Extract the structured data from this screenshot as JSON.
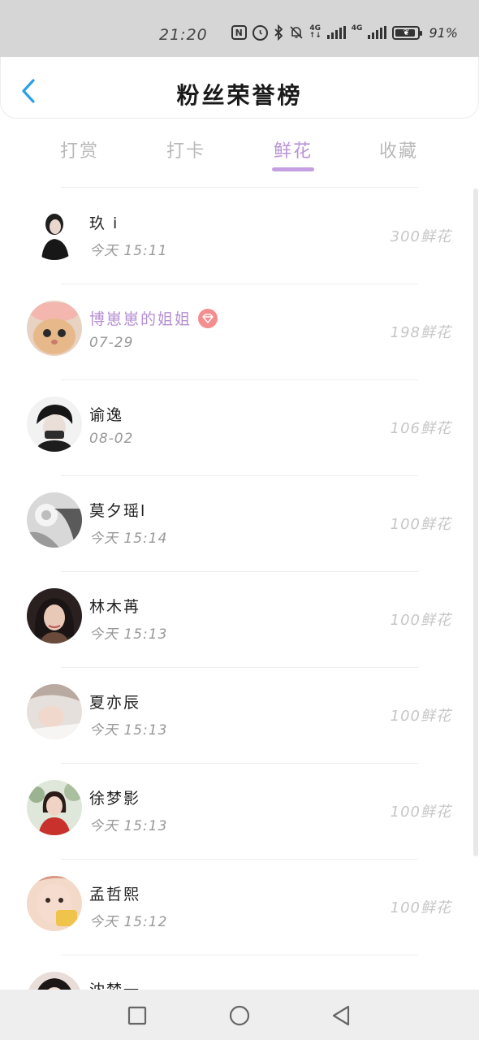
{
  "status_bar": {
    "time": "21:20",
    "network_label_1": "4G",
    "network_label_2": "4G",
    "battery_percent": "91%",
    "battery_level": 0.91,
    "icons": [
      "nfc-icon",
      "alarm-icon",
      "bluetooth-icon",
      "mute-icon",
      "signal-icon",
      "signal-icon",
      "battery-icon"
    ]
  },
  "header": {
    "title": "粉丝荣誉榜",
    "back_icon": "chevron-left-icon",
    "accent_color": "#2aa0e6"
  },
  "tabs": [
    {
      "label": "打赏",
      "active": false
    },
    {
      "label": "打卡",
      "active": false
    },
    {
      "label": "鲜花",
      "active": true
    },
    {
      "label": "收藏",
      "active": false
    }
  ],
  "colors": {
    "accent": "#b893d6",
    "muted_text": "#999999",
    "amount_text": "#c6c6c6",
    "vip_badge": "#f48d8d"
  },
  "fans": [
    {
      "name": "玖 i",
      "time": "今天 15:11",
      "amount": "300鲜花",
      "highlight": false,
      "vip": false
    },
    {
      "name": "博崽崽的姐姐",
      "time": "07-29",
      "amount": "198鲜花",
      "highlight": true,
      "vip": true
    },
    {
      "name": "谕逸",
      "time": "08-02",
      "amount": "106鲜花",
      "highlight": false,
      "vip": false
    },
    {
      "name": "莫夕瑶l",
      "time": "今天 15:14",
      "amount": "100鲜花",
      "highlight": false,
      "vip": false
    },
    {
      "name": "林木苒",
      "time": "今天 15:13",
      "amount": "100鲜花",
      "highlight": false,
      "vip": false
    },
    {
      "name": "夏亦辰",
      "time": "今天 15:13",
      "amount": "100鲜花",
      "highlight": false,
      "vip": false
    },
    {
      "name": "徐梦影",
      "time": "今天 15:13",
      "amount": "100鲜花",
      "highlight": false,
      "vip": false
    },
    {
      "name": "孟哲熙",
      "time": "今天 15:12",
      "amount": "100鲜花",
      "highlight": false,
      "vip": false
    },
    {
      "name": "沈梦一",
      "time": "",
      "amount": "",
      "highlight": false,
      "vip": false
    }
  ],
  "nav_bar": {
    "buttons": [
      "recent-apps-icon",
      "home-icon",
      "back-icon"
    ]
  }
}
